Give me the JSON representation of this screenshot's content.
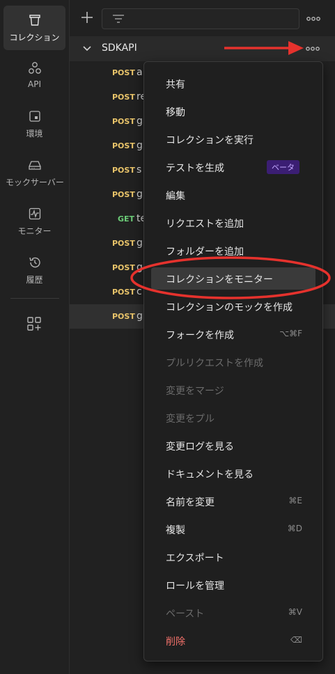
{
  "sidebar": {
    "items": [
      {
        "label": "コレクション",
        "icon": "trash-can-icon",
        "active": true
      },
      {
        "label": "API",
        "icon": "api-nodes-icon"
      },
      {
        "label": "環境",
        "icon": "environment-icon"
      },
      {
        "label": "モックサーバー",
        "icon": "mock-server-icon"
      },
      {
        "label": "モニター",
        "icon": "monitor-icon"
      },
      {
        "label": "履歴",
        "icon": "history-icon"
      }
    ]
  },
  "collection": {
    "name": "SDKAPI"
  },
  "requests": [
    {
      "method": "POST",
      "name": "a"
    },
    {
      "method": "POST",
      "name": "re"
    },
    {
      "method": "POST",
      "name": "g"
    },
    {
      "method": "POST",
      "name": "g"
    },
    {
      "method": "POST",
      "name": "s"
    },
    {
      "method": "POST",
      "name": "g"
    },
    {
      "method": "GET",
      "name": "te"
    },
    {
      "method": "POST",
      "name": "g"
    },
    {
      "method": "POST",
      "name": "g"
    },
    {
      "method": "POST",
      "name": "c"
    },
    {
      "method": "POST",
      "name": "g"
    }
  ],
  "menu": {
    "items": [
      {
        "label": "共有"
      },
      {
        "label": "移動"
      },
      {
        "label": "コレクションを実行"
      },
      {
        "label": "テストを生成",
        "badge": "ベータ"
      },
      {
        "label": "編集"
      },
      {
        "label": "リクエストを追加"
      },
      {
        "label": "フォルダーを追加"
      },
      {
        "label": "コレクションをモニター",
        "highlighted": true
      },
      {
        "label": "コレクションのモックを作成"
      },
      {
        "label": "フォークを作成",
        "shortcut": "⌥⌘F"
      },
      {
        "label": "プルリクエストを作成",
        "disabled": true
      },
      {
        "label": "変更をマージ",
        "disabled": true
      },
      {
        "label": "変更をプル",
        "disabled": true
      },
      {
        "label": "変更ログを見る"
      },
      {
        "label": "ドキュメントを見る"
      },
      {
        "label": "名前を変更",
        "shortcut": "⌘E"
      },
      {
        "label": "複製",
        "shortcut": "⌘D"
      },
      {
        "label": "エクスポート"
      },
      {
        "label": "ロールを管理"
      },
      {
        "label": "ペースト",
        "shortcut": "⌘V",
        "disabled": true
      },
      {
        "label": "削除",
        "shortcut": "⌫",
        "danger": true
      }
    ]
  },
  "colors": {
    "post": "#e9c46a",
    "get": "#6bcb77",
    "annotation": "#e5322d",
    "danger": "#f2716a"
  }
}
